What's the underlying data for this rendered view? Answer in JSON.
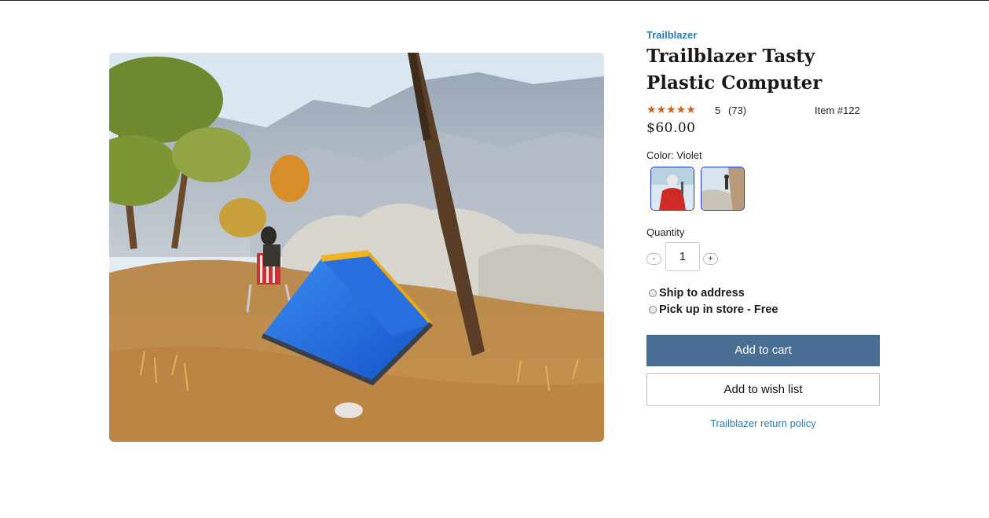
{
  "product": {
    "brand": "Trailblazer",
    "title": "Trailblazer Tasty Plastic Computer",
    "rating_stars": "★★★★★",
    "rating": "5",
    "review_count": "(73)",
    "item_number": "Item #122",
    "price": "$60.00"
  },
  "color": {
    "label": "Color: Violet",
    "swatches": [
      "climber-red-jacket",
      "rock-climber"
    ]
  },
  "quantity": {
    "label": "Quantity",
    "value": "1",
    "minus": "-",
    "plus": "+"
  },
  "fulfillment": {
    "ship": "Ship to address",
    "pickup": "Pick up in store - Free"
  },
  "actions": {
    "add_to_cart": "Add to cart",
    "add_to_wish_list": "Add to wish list",
    "return_policy": "Trailblazer return policy"
  },
  "colors": {
    "brand_link": "#2a7ab8",
    "cart_button": "#4a6f94",
    "star": "#c8621c"
  }
}
